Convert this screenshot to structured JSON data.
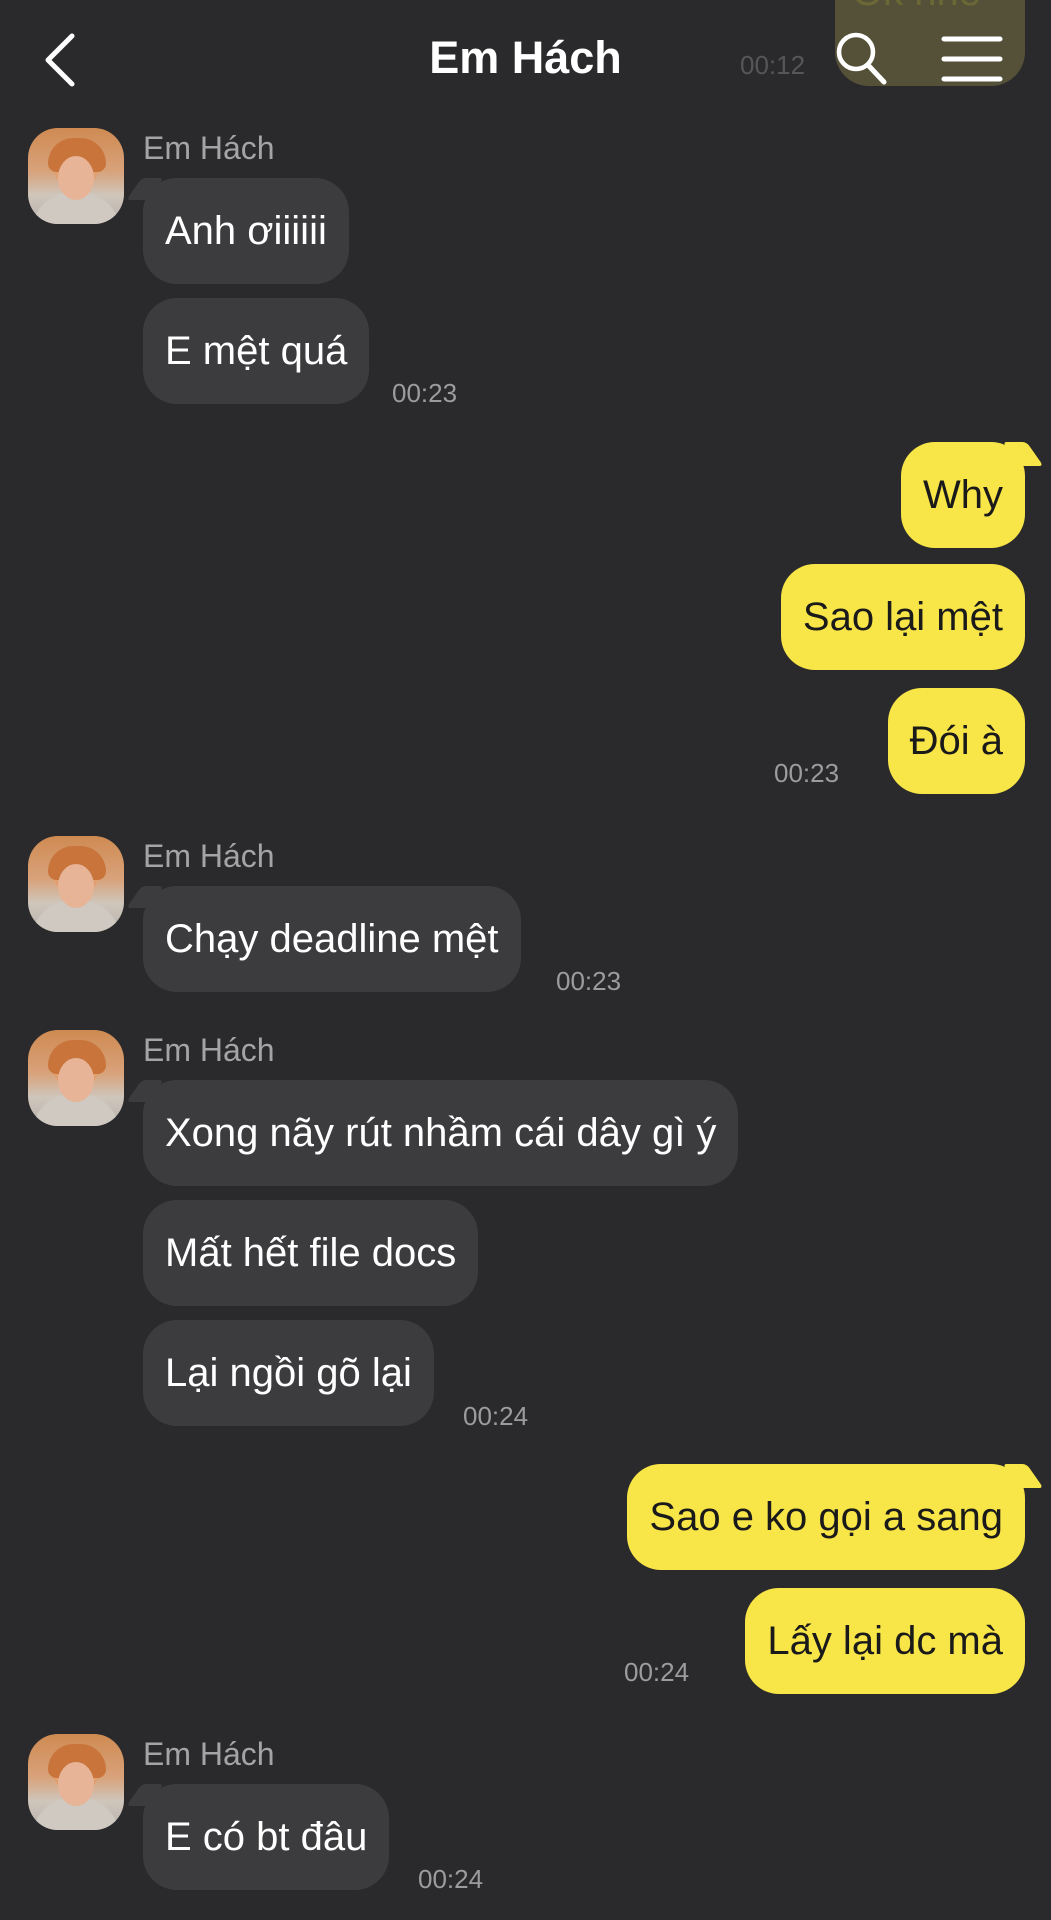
{
  "header": {
    "title": "Em Hách",
    "back_icon": "chevron-left-icon",
    "search_icon": "search-icon",
    "menu_icon": "hamburger-menu-icon",
    "ghost_message": "Ok nhé",
    "ghost_time": "00:12"
  },
  "messages": [
    {
      "sender": "Em Hách",
      "bubbles": [
        "Anh ơiiiiii",
        "E mệt quá"
      ],
      "time": "00:23"
    },
    {
      "sender": "me",
      "bubbles": [
        "Why",
        "Sao lại mệt",
        "Đói à"
      ],
      "time": "00:23"
    },
    {
      "sender": "Em Hách",
      "bubbles": [
        "Chạy deadline mệt"
      ],
      "time": "00:23"
    },
    {
      "sender": "Em Hách",
      "bubbles": [
        "Xong nãy rút nhầm cái dây gì ý",
        "Mất hết file docs",
        "Lại ngồi gõ lại"
      ],
      "time": "00:24"
    },
    {
      "sender": "me",
      "bubbles": [
        "Sao e ko gọi a sang",
        "Lấy lại dc mà"
      ],
      "time": "00:24"
    },
    {
      "sender": "Em Hách",
      "bubbles": [
        "E có bt đâu"
      ],
      "time": "00:24"
    }
  ],
  "colors": {
    "background": "#2a2a2c",
    "incoming_bubble": "#3c3c3e",
    "outgoing_bubble": "#f8e547"
  }
}
